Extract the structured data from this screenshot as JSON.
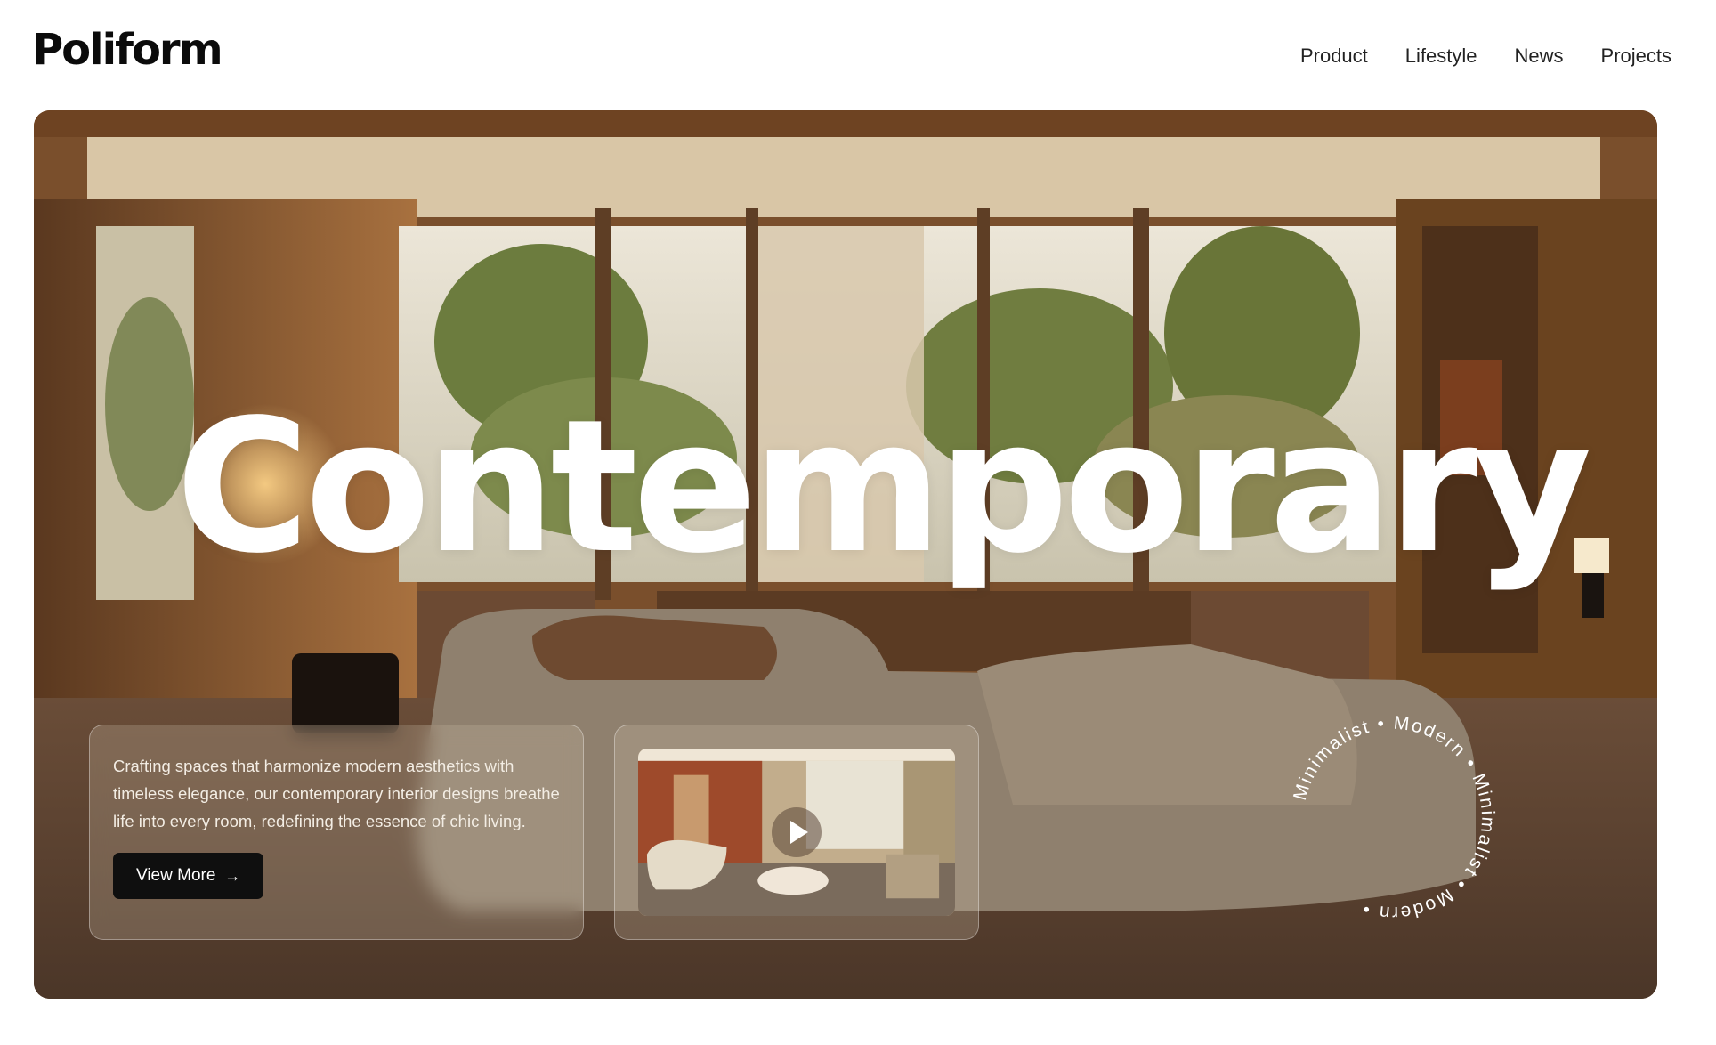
{
  "brand": {
    "logo": "Poliform"
  },
  "nav": [
    {
      "label": "Product"
    },
    {
      "label": "Lifestyle"
    },
    {
      "label": "News"
    },
    {
      "label": "Projects"
    }
  ],
  "hero": {
    "headline": "Contemporary",
    "description": "Crafting spaces that harmonize modern aesthetics with timeless elegance, our contemporary interior designs breathe life into every room, redefining the essence of chic living.",
    "cta_label": "View More",
    "cta_icon": "arrow-right-icon",
    "video_icon": "play-icon",
    "badge_text": "Minimalist • Modern • Minimalist • Modern • "
  }
}
